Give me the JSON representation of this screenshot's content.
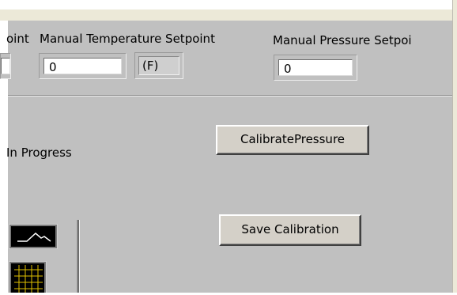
{
  "labels": {
    "setpoint_partial": "oint",
    "manual_temperature": "Manual Temperature Setpoint",
    "manual_pressure": "Manual Pressure Setpoi",
    "in_progress_partial": "In Progress"
  },
  "fields": {
    "manual_temperature_value": "0",
    "temperature_unit": "(F)",
    "manual_pressure_value": "0"
  },
  "buttons": {
    "calibrate_pressure": "CalibratePressure",
    "save_calibration": "Save Calibration"
  },
  "icons": {
    "plot_style": "line-plot-icon",
    "grid_style": "grid-icon"
  },
  "colors": {
    "panel": "#c0c0c0",
    "button_face": "#d4d0c8",
    "plot_line": "#ffffff",
    "grid_line": "#e0c000"
  }
}
